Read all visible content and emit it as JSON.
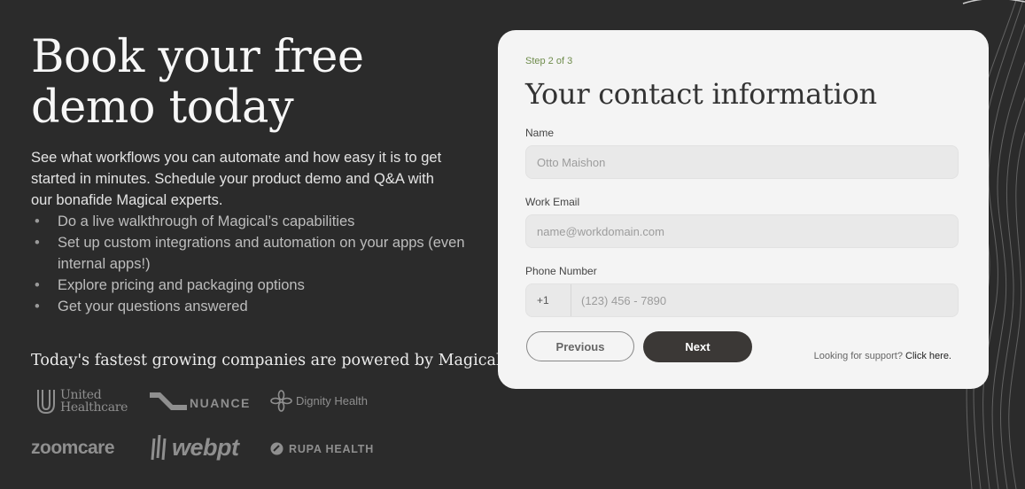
{
  "left": {
    "headline_line1": "Book your free",
    "headline_line2": "demo today",
    "intro": "See what workflows you can automate and how easy it is to get started in minutes. Schedule your product demo and Q&A with our bonafide Magical experts.",
    "bullets": [
      "Do a live walkthrough of Magical’s capabilities",
      "Set up custom integrations and automation on your apps (even internal apps!)",
      "Explore pricing and packaging options",
      "Get your questions answered"
    ],
    "bullet_char": "•",
    "powered_by": "Today's fastest growing companies are powered by Magical"
  },
  "logos": {
    "united_healthcare_line1": "United",
    "united_healthcare_line2": "Healthcare",
    "nuance": "NUANCE",
    "dignity_health": "Dignity Health",
    "zoomcare": "zoomcare",
    "webpt": "webpt",
    "rupa_health": "RUPA HEALTH"
  },
  "form": {
    "step": "Step 2 of 3",
    "title": "Your contact information",
    "name_label": "Name",
    "name_placeholder": "Otto Maishon",
    "email_label": "Work Email",
    "email_placeholder": "name@workdomain.com",
    "phone_label": "Phone Number",
    "country_code": "+1",
    "phone_placeholder": "(123) 456 - 7890",
    "previous_label": "Previous",
    "next_label": "Next",
    "support_text": "Looking for support?",
    "support_link": "Click here."
  },
  "colors": {
    "background": "#2b2b2b",
    "card": "#f4f4f4",
    "step_green": "#6f8c4c",
    "next_button": "#3b3836"
  }
}
